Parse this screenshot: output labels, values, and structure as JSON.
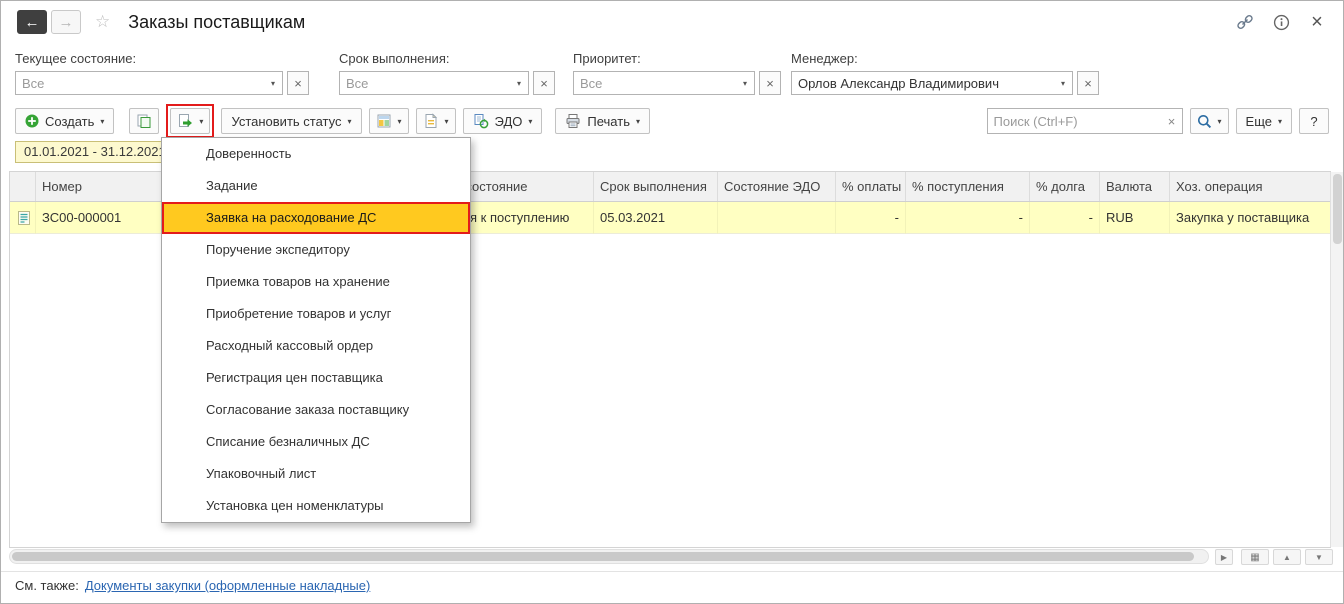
{
  "window": {
    "title": "Заказы поставщикам"
  },
  "filters": [
    {
      "label": "Текущее состояние:",
      "value": "Все"
    },
    {
      "label": "Срок выполнения:",
      "value": "Все"
    },
    {
      "label": "Приоритет:",
      "value": "Все"
    },
    {
      "label": "Менеджер:",
      "value": "Орлов Александр Владимирович"
    }
  ],
  "toolbar": {
    "create": "Создать",
    "set_status": "Установить статус",
    "edo": "ЭДО",
    "print": "Печать",
    "search_placeholder": "Поиск (Ctrl+F)",
    "more": "Еще",
    "help": "?"
  },
  "period_filter": "01.01.2021 - 31.12.2021",
  "context_menu": {
    "items": [
      "Доверенность",
      "Задание",
      "Заявка на расходование ДС",
      "Поручение экспедитору",
      "Приемка товаров на хранение",
      "Приобретение товаров и услуг",
      "Расходный кассовый ордер",
      "Регистрация цен поставщика",
      "Согласование заказа поставщику",
      "Списание безналичных ДС",
      "Упаковочный лист",
      "Установка цен номенклатуры"
    ],
    "highlighted_item": "Заявка на расходование ДС"
  },
  "table": {
    "headers": [
      "Номер",
      "Текущее состояние",
      "Срок выполнения",
      "Состояние ЭДО",
      "% оплаты",
      "% поступления",
      "% долга",
      "Валюта",
      "Хоз. операция"
    ],
    "rows": [
      {
        "number": "ЗС00-000001",
        "current_state": "Ожидается к поступлению",
        "due_date": "05.03.2021",
        "edo_state": "",
        "payment_percent": "-",
        "receipt_percent": "-",
        "debt_percent": "-",
        "currency": "RUB",
        "operation": "Закупка у поставщика"
      }
    ]
  },
  "footer": {
    "see_also_label": "См. также:",
    "see_also_link": "Документы закупки (оформленные накладные)"
  },
  "icons": {
    "back": "←",
    "forward": "→",
    "star": "☆",
    "close": "×",
    "caret": "▾",
    "clear": "×",
    "scroll_right": "▶",
    "scroll_up": "▲",
    "scroll_down": "▼",
    "grid": "▦"
  },
  "colors": {
    "menu_highlight": "#ffc91f",
    "annotation": "#e31b1b",
    "selected_row": "#ffffc2",
    "link": "#2b66b2"
  }
}
